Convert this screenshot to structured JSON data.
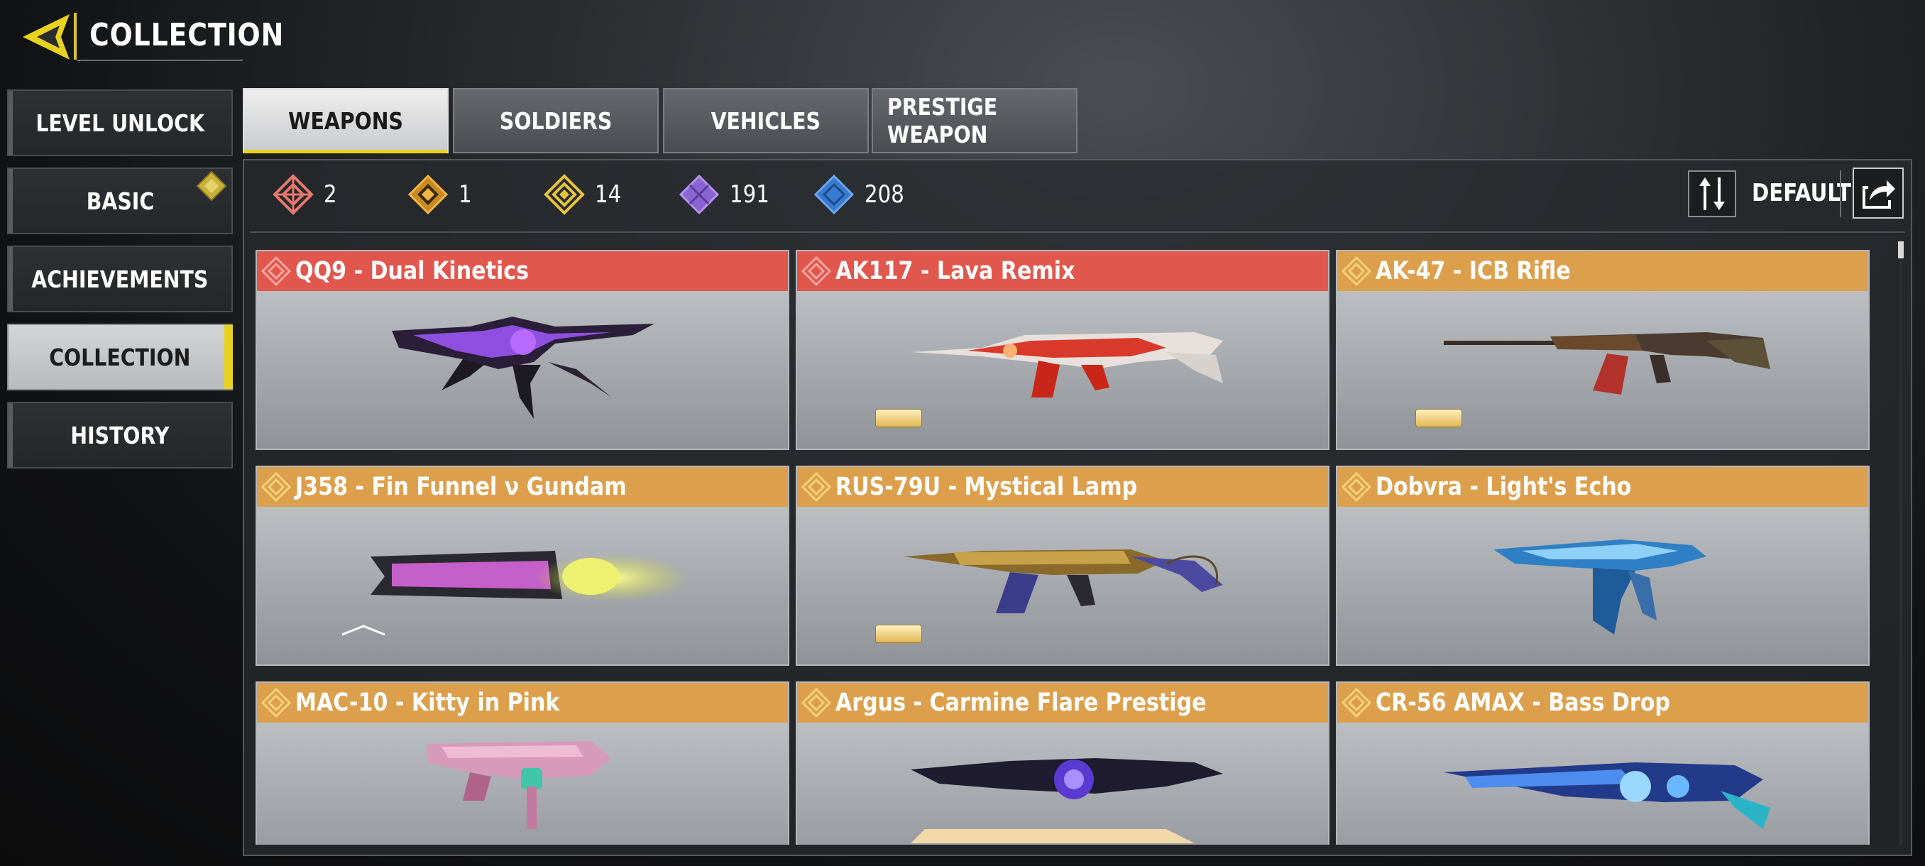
{
  "header": {
    "title": "COLLECTION",
    "accent": "#e8d21f"
  },
  "side_menu": {
    "items": [
      {
        "label": "LEVEL UNLOCK",
        "active": false
      },
      {
        "label": "BASIC",
        "active": false,
        "badge": "diamond-badge"
      },
      {
        "label": "ACHIEVEMENTS",
        "active": false
      },
      {
        "label": "COLLECTION",
        "active": true
      },
      {
        "label": "HISTORY",
        "active": false
      }
    ]
  },
  "tabs": [
    {
      "label": "WEAPONS",
      "active": true
    },
    {
      "label": "SOLDIERS",
      "active": false
    },
    {
      "label": "VEHICLES",
      "active": false
    },
    {
      "label": "PRESTIGE WEAPON",
      "active": false
    }
  ],
  "rarity_counts": [
    {
      "icon": "mythic-rarity-icon",
      "color": "#e1574d",
      "count": "2"
    },
    {
      "icon": "legendary-plus-rarity-icon",
      "color": "#e7a63a",
      "count": "1"
    },
    {
      "icon": "legendary-rarity-icon",
      "color": "#e7c53a",
      "count": "14"
    },
    {
      "icon": "epic-rarity-icon",
      "color": "#a97ee6",
      "count": "191"
    },
    {
      "icon": "rare-rarity-icon",
      "color": "#4d92e6",
      "count": "208"
    }
  ],
  "sort": {
    "label": "DEFAULT"
  },
  "cards": [
    {
      "name": "QQ9 - Dual Kinetics",
      "rarity": "mythic",
      "tag": false,
      "art": "purple-smg"
    },
    {
      "name": "AK117 - Lava Remix",
      "rarity": "mythic",
      "tag": true,
      "art": "lava-rifle"
    },
    {
      "name": "AK-47 - ICB Rifle",
      "rarity": "legendary",
      "tag": true,
      "art": "ak-rifle"
    },
    {
      "name": "J358 - Fin Funnel ν Gundam",
      "rarity": "legendary",
      "tag": false,
      "art": "gundam-pistol"
    },
    {
      "name": "RUS-79U - Mystical Lamp",
      "rarity": "legendary",
      "tag": true,
      "art": "gold-smg"
    },
    {
      "name": "Dobvra - Light's Echo",
      "rarity": "legendary",
      "tag": false,
      "art": "blue-smg"
    },
    {
      "name": "MAC-10 - Kitty in Pink",
      "rarity": "legendary",
      "tag": false,
      "art": "pink-smg"
    },
    {
      "name": "Argus - Carmine Flare Prestige",
      "rarity": "legendary",
      "tag": false,
      "art": "dark-shotgun"
    },
    {
      "name": "CR-56 AMAX - Bass Drop",
      "rarity": "legendary",
      "tag": false,
      "art": "neon-rifle"
    }
  ]
}
